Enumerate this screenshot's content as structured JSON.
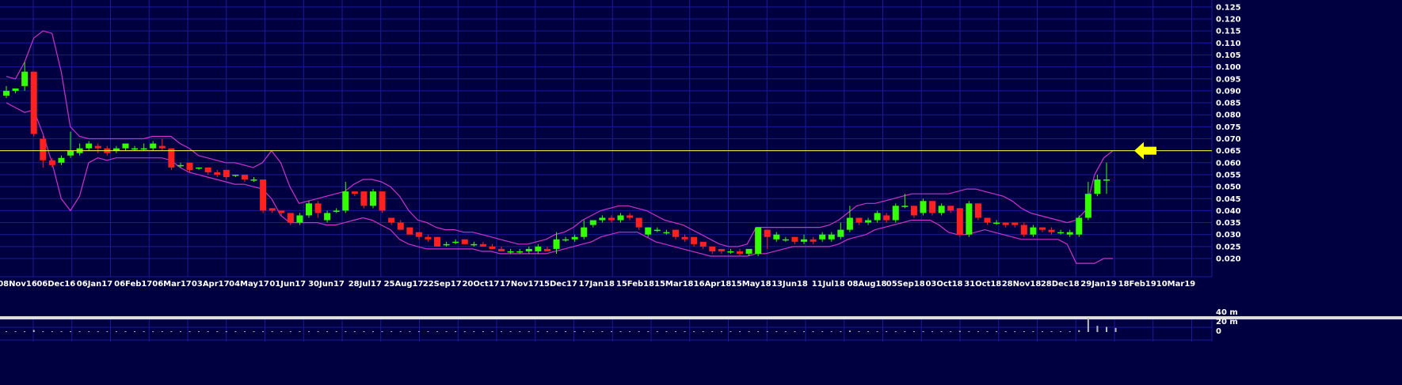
{
  "chart_data": {
    "type": "candlestick",
    "x_tick_labels": [
      "08Nov16",
      "06Dec16",
      "06Jan17",
      "06Feb17",
      "06Mar17",
      "03Apr17",
      "04May17",
      "01Jun17",
      "30Jun17",
      "28Jul17",
      "25Aug17",
      "22Sep17",
      "20Oct17",
      "17Nov17",
      "15Dec17",
      "17Jan18",
      "15Feb18",
      "15Mar18",
      "16Apr18",
      "15May18",
      "13Jun18",
      "11Jul18",
      "08Aug18",
      "05Sep18",
      "03Oct18",
      "31Oct18",
      "28Nov18",
      "28Dec18",
      "29Jan19",
      "18Feb19",
      "10Mar19"
    ],
    "y_tick_labels": [
      "0.020",
      "0.025",
      "0.030",
      "0.035",
      "0.040",
      "0.045",
      "0.050",
      "0.055",
      "0.060",
      "0.065",
      "0.070",
      "0.075",
      "0.080",
      "0.085",
      "0.090",
      "0.095",
      "0.100",
      "0.105",
      "0.110",
      "0.115",
      "0.120",
      "0.125"
    ],
    "ylim": [
      0.016,
      0.127
    ],
    "volume_tick_labels": [
      "40 m",
      "20 m",
      "0"
    ],
    "resistance_level": 0.065,
    "colors": {
      "background": "#000040",
      "grid": "#1a1a9a",
      "up": "#33ff00",
      "down": "#ff2020",
      "band": "#cc33cc",
      "resistance": "#ffff33",
      "arrow": "#ffff00",
      "volume": "#bbbbbb"
    },
    "candles": [
      [
        0.088,
        0.09,
        0.087,
        0.092
      ],
      [
        0.09,
        0.091,
        0.089,
        0.091
      ],
      [
        0.092,
        0.098,
        0.09,
        0.102
      ],
      [
        0.098,
        0.072,
        0.071,
        0.098
      ],
      [
        0.07,
        0.061,
        0.058,
        0.071
      ],
      [
        0.061,
        0.059,
        0.058,
        0.062
      ],
      [
        0.06,
        0.062,
        0.059,
        0.063
      ],
      [
        0.063,
        0.065,
        0.062,
        0.073
      ],
      [
        0.064,
        0.066,
        0.063,
        0.068
      ],
      [
        0.066,
        0.068,
        0.065,
        0.069
      ],
      [
        0.067,
        0.066,
        0.064,
        0.068
      ],
      [
        0.066,
        0.064,
        0.063,
        0.067
      ],
      [
        0.065,
        0.066,
        0.064,
        0.067
      ],
      [
        0.066,
        0.068,
        0.065,
        0.068
      ],
      [
        0.066,
        0.066,
        0.065,
        0.067
      ],
      [
        0.066,
        0.066,
        0.065,
        0.068
      ],
      [
        0.066,
        0.068,
        0.065,
        0.069
      ],
      [
        0.067,
        0.066,
        0.065,
        0.07
      ],
      [
        0.066,
        0.058,
        0.057,
        0.066
      ],
      [
        0.059,
        0.059,
        0.058,
        0.06
      ],
      [
        0.06,
        0.057,
        0.056,
        0.06
      ],
      [
        0.058,
        0.058,
        0.057,
        0.058
      ],
      [
        0.058,
        0.056,
        0.055,
        0.058
      ],
      [
        0.056,
        0.055,
        0.054,
        0.057
      ],
      [
        0.057,
        0.054,
        0.053,
        0.057
      ],
      [
        0.055,
        0.055,
        0.054,
        0.055
      ],
      [
        0.055,
        0.053,
        0.052,
        0.055
      ],
      [
        0.053,
        0.053,
        0.052,
        0.054
      ],
      [
        0.053,
        0.04,
        0.039,
        0.053
      ],
      [
        0.041,
        0.04,
        0.039,
        0.041
      ],
      [
        0.04,
        0.039,
        0.038,
        0.04
      ],
      [
        0.039,
        0.035,
        0.034,
        0.039
      ],
      [
        0.035,
        0.038,
        0.034,
        0.039
      ],
      [
        0.038,
        0.043,
        0.037,
        0.044
      ],
      [
        0.043,
        0.039,
        0.037,
        0.044
      ],
      [
        0.036,
        0.039,
        0.035,
        0.04
      ],
      [
        0.04,
        0.04,
        0.039,
        0.041
      ],
      [
        0.04,
        0.048,
        0.039,
        0.052
      ],
      [
        0.048,
        0.047,
        0.046,
        0.048
      ],
      [
        0.048,
        0.042,
        0.041,
        0.048
      ],
      [
        0.042,
        0.048,
        0.041,
        0.049
      ],
      [
        0.048,
        0.04,
        0.039,
        0.048
      ],
      [
        0.037,
        0.035,
        0.034,
        0.037
      ],
      [
        0.035,
        0.032,
        0.032,
        0.036
      ],
      [
        0.033,
        0.03,
        0.03,
        0.033
      ],
      [
        0.031,
        0.029,
        0.028,
        0.031
      ],
      [
        0.029,
        0.028,
        0.027,
        0.03
      ],
      [
        0.029,
        0.025,
        0.025,
        0.029
      ],
      [
        0.026,
        0.026,
        0.025,
        0.027
      ],
      [
        0.027,
        0.027,
        0.026,
        0.028
      ],
      [
        0.028,
        0.026,
        0.026,
        0.028
      ],
      [
        0.026,
        0.026,
        0.025,
        0.027
      ],
      [
        0.026,
        0.025,
        0.025,
        0.027
      ],
      [
        0.025,
        0.024,
        0.024,
        0.026
      ],
      [
        0.024,
        0.023,
        0.023,
        0.025
      ],
      [
        0.023,
        0.023,
        0.022,
        0.024
      ],
      [
        0.023,
        0.023,
        0.022,
        0.024
      ],
      [
        0.023,
        0.024,
        0.022,
        0.025
      ],
      [
        0.023,
        0.025,
        0.022,
        0.026
      ],
      [
        0.024,
        0.023,
        0.023,
        0.025
      ],
      [
        0.024,
        0.028,
        0.022,
        0.031
      ],
      [
        0.028,
        0.028,
        0.027,
        0.029
      ],
      [
        0.028,
        0.029,
        0.027,
        0.03
      ],
      [
        0.029,
        0.033,
        0.028,
        0.036
      ],
      [
        0.034,
        0.036,
        0.033,
        0.036
      ],
      [
        0.036,
        0.037,
        0.035,
        0.038
      ],
      [
        0.037,
        0.036,
        0.035,
        0.038
      ],
      [
        0.036,
        0.038,
        0.035,
        0.039
      ],
      [
        0.038,
        0.037,
        0.036,
        0.039
      ],
      [
        0.037,
        0.033,
        0.032,
        0.037
      ],
      [
        0.03,
        0.033,
        0.029,
        0.033
      ],
      [
        0.032,
        0.032,
        0.031,
        0.033
      ],
      [
        0.031,
        0.031,
        0.03,
        0.032
      ],
      [
        0.032,
        0.029,
        0.028,
        0.032
      ],
      [
        0.029,
        0.028,
        0.027,
        0.03
      ],
      [
        0.029,
        0.026,
        0.025,
        0.029
      ],
      [
        0.027,
        0.025,
        0.024,
        0.027
      ],
      [
        0.025,
        0.023,
        0.022,
        0.025
      ],
      [
        0.024,
        0.023,
        0.022,
        0.024
      ],
      [
        0.023,
        0.023,
        0.022,
        0.024
      ],
      [
        0.023,
        0.022,
        0.021,
        0.024
      ],
      [
        0.022,
        0.024,
        0.021,
        0.024
      ],
      [
        0.022,
        0.033,
        0.021,
        0.033
      ],
      [
        0.032,
        0.029,
        0.024,
        0.032
      ],
      [
        0.028,
        0.03,
        0.027,
        0.031
      ],
      [
        0.028,
        0.028,
        0.027,
        0.029
      ],
      [
        0.029,
        0.027,
        0.026,
        0.029
      ],
      [
        0.027,
        0.028,
        0.026,
        0.03
      ],
      [
        0.028,
        0.027,
        0.026,
        0.029
      ],
      [
        0.028,
        0.03,
        0.027,
        0.031
      ],
      [
        0.028,
        0.03,
        0.027,
        0.031
      ],
      [
        0.029,
        0.032,
        0.028,
        0.035
      ],
      [
        0.032,
        0.037,
        0.031,
        0.042
      ],
      [
        0.037,
        0.035,
        0.034,
        0.037
      ],
      [
        0.035,
        0.036,
        0.034,
        0.037
      ],
      [
        0.036,
        0.039,
        0.035,
        0.04
      ],
      [
        0.038,
        0.036,
        0.035,
        0.039
      ],
      [
        0.036,
        0.042,
        0.035,
        0.043
      ],
      [
        0.042,
        0.042,
        0.041,
        0.047
      ],
      [
        0.042,
        0.038,
        0.037,
        0.042
      ],
      [
        0.039,
        0.044,
        0.038,
        0.045
      ],
      [
        0.044,
        0.039,
        0.038,
        0.044
      ],
      [
        0.039,
        0.042,
        0.038,
        0.043
      ],
      [
        0.042,
        0.04,
        0.039,
        0.042
      ],
      [
        0.041,
        0.03,
        0.029,
        0.041
      ],
      [
        0.03,
        0.043,
        0.029,
        0.044
      ],
      [
        0.043,
        0.037,
        0.036,
        0.043
      ],
      [
        0.037,
        0.035,
        0.034,
        0.037
      ],
      [
        0.035,
        0.035,
        0.034,
        0.036
      ],
      [
        0.035,
        0.034,
        0.033,
        0.035
      ],
      [
        0.035,
        0.034,
        0.033,
        0.035
      ],
      [
        0.034,
        0.03,
        0.029,
        0.035
      ],
      [
        0.03,
        0.033,
        0.029,
        0.034
      ],
      [
        0.033,
        0.032,
        0.031,
        0.033
      ],
      [
        0.032,
        0.031,
        0.03,
        0.033
      ],
      [
        0.031,
        0.031,
        0.03,
        0.032
      ],
      [
        0.03,
        0.031,
        0.029,
        0.032
      ],
      [
        0.03,
        0.037,
        0.029,
        0.038
      ],
      [
        0.037,
        0.047,
        0.036,
        0.052
      ],
      [
        0.047,
        0.053,
        0.046,
        0.055
      ],
      [
        0.053,
        0.053,
        0.047,
        0.06
      ]
    ],
    "bollinger": {
      "upper": [
        0.096,
        0.095,
        0.102,
        0.112,
        0.115,
        0.114,
        0.098,
        0.075,
        0.071,
        0.07,
        0.07,
        0.07,
        0.07,
        0.07,
        0.07,
        0.07,
        0.071,
        0.071,
        0.071,
        0.068,
        0.066,
        0.063,
        0.062,
        0.061,
        0.06,
        0.06,
        0.059,
        0.058,
        0.06,
        0.065,
        0.06,
        0.05,
        0.043,
        0.044,
        0.045,
        0.046,
        0.047,
        0.048,
        0.051,
        0.053,
        0.053,
        0.052,
        0.05,
        0.046,
        0.04,
        0.036,
        0.035,
        0.033,
        0.032,
        0.032,
        0.031,
        0.031,
        0.03,
        0.029,
        0.028,
        0.027,
        0.026,
        0.026,
        0.027,
        0.028,
        0.03,
        0.031,
        0.033,
        0.036,
        0.038,
        0.04,
        0.041,
        0.042,
        0.042,
        0.041,
        0.04,
        0.038,
        0.036,
        0.035,
        0.034,
        0.032,
        0.03,
        0.028,
        0.026,
        0.025,
        0.025,
        0.026,
        0.033,
        0.033,
        0.033,
        0.033,
        0.033,
        0.033,
        0.033,
        0.033,
        0.034,
        0.036,
        0.039,
        0.042,
        0.043,
        0.043,
        0.044,
        0.045,
        0.046,
        0.047,
        0.047,
        0.047,
        0.047,
        0.047,
        0.048,
        0.049,
        0.049,
        0.048,
        0.047,
        0.046,
        0.044,
        0.041,
        0.039,
        0.038,
        0.037,
        0.036,
        0.035,
        0.036,
        0.04,
        0.055,
        0.062,
        0.065
      ],
      "lower": [
        0.085,
        0.083,
        0.081,
        0.082,
        0.072,
        0.06,
        0.045,
        0.04,
        0.046,
        0.06,
        0.062,
        0.061,
        0.062,
        0.062,
        0.062,
        0.062,
        0.062,
        0.062,
        0.061,
        0.058,
        0.056,
        0.055,
        0.054,
        0.053,
        0.052,
        0.051,
        0.051,
        0.05,
        0.049,
        0.045,
        0.038,
        0.035,
        0.035,
        0.035,
        0.035,
        0.034,
        0.034,
        0.035,
        0.036,
        0.037,
        0.036,
        0.034,
        0.032,
        0.028,
        0.026,
        0.025,
        0.024,
        0.024,
        0.024,
        0.024,
        0.024,
        0.024,
        0.023,
        0.023,
        0.022,
        0.022,
        0.022,
        0.022,
        0.022,
        0.022,
        0.023,
        0.024,
        0.025,
        0.026,
        0.027,
        0.029,
        0.03,
        0.031,
        0.031,
        0.031,
        0.029,
        0.027,
        0.026,
        0.025,
        0.024,
        0.023,
        0.022,
        0.021,
        0.021,
        0.021,
        0.021,
        0.021,
        0.022,
        0.022,
        0.023,
        0.024,
        0.025,
        0.025,
        0.025,
        0.025,
        0.025,
        0.026,
        0.028,
        0.029,
        0.03,
        0.032,
        0.033,
        0.034,
        0.035,
        0.036,
        0.036,
        0.036,
        0.034,
        0.031,
        0.03,
        0.03,
        0.031,
        0.032,
        0.031,
        0.03,
        0.029,
        0.028,
        0.028,
        0.028,
        0.028,
        0.028,
        0.026,
        0.018,
        0.018,
        0.018,
        0.02,
        0.02
      ]
    },
    "volume": [
      0.5,
      0.3,
      0.4,
      4.0,
      1.5,
      0.8,
      0.6,
      0.9,
      0.7,
      0.5,
      0.6,
      0.4,
      0.5,
      0.6,
      0.5,
      0.4,
      0.6,
      0.5,
      0.8,
      0.6,
      0.5,
      0.4,
      0.4,
      0.5,
      0.4,
      0.3,
      0.4,
      0.3,
      1.2,
      0.7,
      0.5,
      0.6,
      0.7,
      0.9,
      0.6,
      0.5,
      0.5,
      1.0,
      0.6,
      0.7,
      0.6,
      0.8,
      0.5,
      0.6,
      0.4,
      0.4,
      0.3,
      0.5,
      0.3,
      0.3,
      0.4,
      0.3,
      0.3,
      0.3,
      0.3,
      0.3,
      0.2,
      0.3,
      0.3,
      0.3,
      0.8,
      0.4,
      0.5,
      0.6,
      0.5,
      0.5,
      0.4,
      0.5,
      0.5,
      0.4,
      0.5,
      0.3,
      0.4,
      0.4,
      0.4,
      0.4,
      0.3,
      0.3,
      0.3,
      0.3,
      0.3,
      0.3,
      1.5,
      0.9,
      0.7,
      0.5,
      0.5,
      0.5,
      0.6,
      0.8,
      1.2,
      1.6,
      2.8,
      1.2,
      1.3,
      1.0,
      1.0,
      1.3,
      1.5,
      1.2,
      1.5,
      1.0,
      1.1,
      1.0,
      2.2,
      1.6,
      1.0,
      0.8,
      0.7,
      0.6,
      0.6,
      0.8,
      0.7,
      0.7,
      0.6,
      0.6,
      1.0,
      3.5,
      27.0,
      12.0,
      10.0,
      8.0
    ]
  }
}
